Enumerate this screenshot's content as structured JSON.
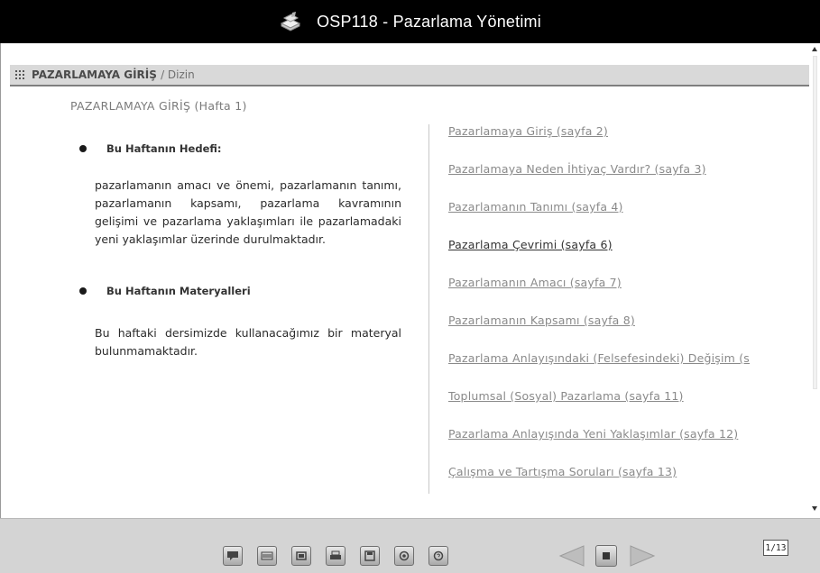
{
  "window": {
    "title": "OSP118 - Pazarlama Yönetimi",
    "logo_icon": "book-stack-icon"
  },
  "section": {
    "title": "PAZARLAMAYA GİRİŞ",
    "subtitle": "/ Dizin"
  },
  "intro": {
    "week_title": "PAZARLAMAYA GİRİŞ (Hafta 1)",
    "goal_heading": "Bu Haftanın Hedefi:",
    "goal_text": "pazarlamanın amacı ve önemi, pazarlamanın tanımı, pazarlamanın kapsamı, pazarlama kavramının gelişimi ve pazarlama yaklaşımları ile pazarlamadaki yeni yaklaşımlar üzerinde durulmaktadır.",
    "materials_heading": "Bu Haftanın Materyalleri",
    "materials_text": "Bu haftaki dersimizde kullanacağımız bir materyal bulunmamaktadır."
  },
  "toc": {
    "items": [
      {
        "label": "Pazarlamaya Giriş (sayfa 2)",
        "active": false
      },
      {
        "label": "Pazarlamaya Neden İhtiyaç Vardır? (sayfa 3)",
        "active": false
      },
      {
        "label": "Pazarlamanın Tanımı (sayfa 4)",
        "active": false
      },
      {
        "label": "Pazarlama Çevrimi (sayfa 6)",
        "active": true
      },
      {
        "label": "Pazarlamanın Amacı (sayfa 7)",
        "active": false
      },
      {
        "label": "Pazarlamanın Kapsamı (sayfa 8)",
        "active": false
      },
      {
        "label": "Pazarlama Anlayışındaki (Felsefesindeki) Değişim (s",
        "active": false
      },
      {
        "label": "Toplumsal (Sosyal) Pazarlama (sayfa 11)",
        "active": false
      },
      {
        "label": "Pazarlama Anlayışında Yeni Yaklaşımlar (sayfa 12)",
        "active": false
      },
      {
        "label": "Çalışma ve Tartışma Soruları (sayfa 13)",
        "active": false
      }
    ]
  },
  "footer": {
    "tools": [
      {
        "name": "comment-icon"
      },
      {
        "name": "keyboard-icon"
      },
      {
        "name": "window-icon"
      },
      {
        "name": "print-icon"
      },
      {
        "name": "save-icon"
      },
      {
        "name": "audio-icon"
      },
      {
        "name": "help-icon"
      }
    ],
    "prev_icon": "arrow-left-icon",
    "home_icon": "home-icon",
    "next_icon": "arrow-right-icon",
    "page_counter": "1/13"
  },
  "colors": {
    "titlebar_bg": "#000000",
    "header_bg": "#d9d9d9",
    "link_inactive": "#8a8a8a",
    "link_active": "#333333",
    "footer_bg": "#d4d4d4"
  }
}
